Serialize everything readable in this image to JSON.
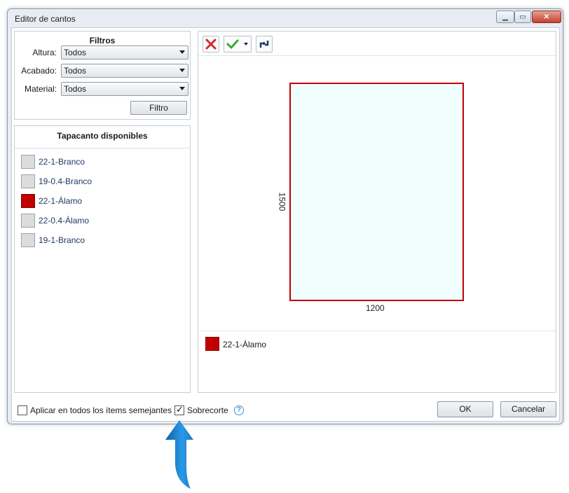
{
  "window": {
    "title": "Editor de cantos",
    "minimize_icon": "▁",
    "maximize_icon": "▭",
    "close_icon": "✕"
  },
  "filters": {
    "title": "Filtros",
    "rows": [
      {
        "label": "Altura:",
        "value": "Todos"
      },
      {
        "label": "Acabado:",
        "value": "Todos"
      },
      {
        "label": "Material:",
        "value": "Todos"
      }
    ],
    "button_label": "Filtro"
  },
  "available": {
    "title": "Tapacanto disponibles",
    "items": [
      {
        "label": "22-1-Branco",
        "color": "#dcdcdc"
      },
      {
        "label": "19-0.4-Branco",
        "color": "#dcdcdc"
      },
      {
        "label": "22-1-Álamo",
        "color": "#c00000"
      },
      {
        "label": "22-0.4-Álamo",
        "color": "#dcdcdc"
      },
      {
        "label": "19-1-Branco",
        "color": "#dcdcdc"
      }
    ]
  },
  "preview": {
    "width_label": "1200",
    "height_label": "1500",
    "edge_color": "#c00000",
    "fill_color": "#f0fefe",
    "legend": {
      "label": "22-1-Álamo",
      "color": "#c00000"
    }
  },
  "bottom": {
    "apply_all_label": "Aplicar en todos los ítems semejantes",
    "apply_all_checked": false,
    "overcut_label": "Sobrecorte",
    "overcut_checked": true,
    "ok_label": "OK",
    "cancel_label": "Cancelar"
  },
  "arrow": {
    "color": "#1e86d6"
  }
}
